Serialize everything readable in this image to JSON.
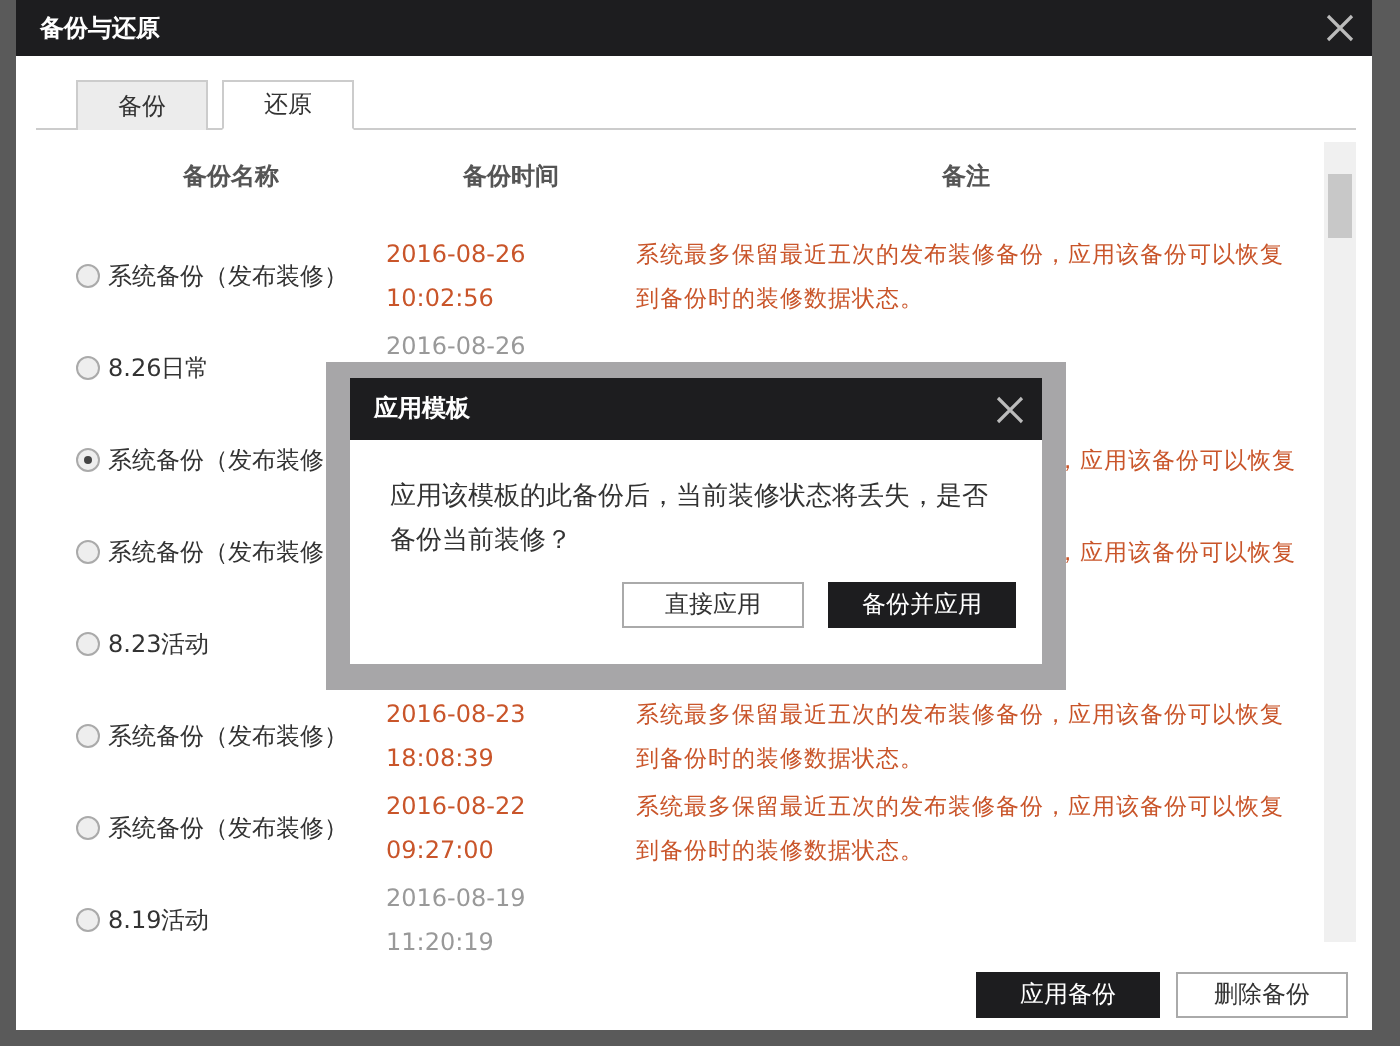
{
  "window": {
    "title": "备份与还原"
  },
  "tabs": [
    {
      "label": "备份",
      "selected": false
    },
    {
      "label": "还原",
      "selected": true
    }
  ],
  "table": {
    "columns": [
      "备份名称",
      "备份时间",
      "备注"
    ],
    "rows": [
      {
        "name": "系统备份（发布装修）",
        "date": "2016-08-26",
        "time": "10:02:56",
        "remark": "系统最多保留最近五次的发布装修备份，应用该备份可以恢复到备份时的装修数据状态。",
        "kind": "system",
        "selected": false
      },
      {
        "name": "8.26日常",
        "date": "2016-08-26",
        "kind": "custom",
        "selected": false
      },
      {
        "name": "系统备份（发布装修",
        "remark": "，应用该备份可以恢复",
        "selected": true
      },
      {
        "name": "系统备份（发布装修",
        "remark": "，应用该备份可以恢复",
        "selected": false
      },
      {
        "name": "8.23活动",
        "selected": false
      },
      {
        "name": "系统备份（发布装修）",
        "date": "2016-08-23",
        "time": "18:08:39",
        "remark": "系统最多保留最近五次的发布装修备份，应用该备份可以恢复到备份时的装修数据状态。",
        "kind": "system",
        "selected": false
      },
      {
        "name": "系统备份（发布装修）",
        "date": "2016-08-22",
        "time": "09:27:00",
        "remark": "系统最多保留最近五次的发布装修备份，应用该备份可以恢复到备份时的装修数据状态。",
        "kind": "system",
        "selected": false
      },
      {
        "name": "8.19活动",
        "date": "2016-08-19",
        "time": "11:20:19",
        "kind": "custom",
        "selected": false
      }
    ]
  },
  "buttons": [
    {
      "label": "应用备份",
      "kind": "primary"
    },
    {
      "label": "删除备份",
      "kind": "secondary"
    }
  ],
  "modal": {
    "title": "应用模板",
    "message": "应用该模板的此备份后，当前装修状态将丢失，是否备份当前装修？",
    "buttons": [
      {
        "label": "直接应用",
        "kind": "secondary"
      },
      {
        "label": "备份并应用",
        "kind": "primary"
      }
    ]
  }
}
